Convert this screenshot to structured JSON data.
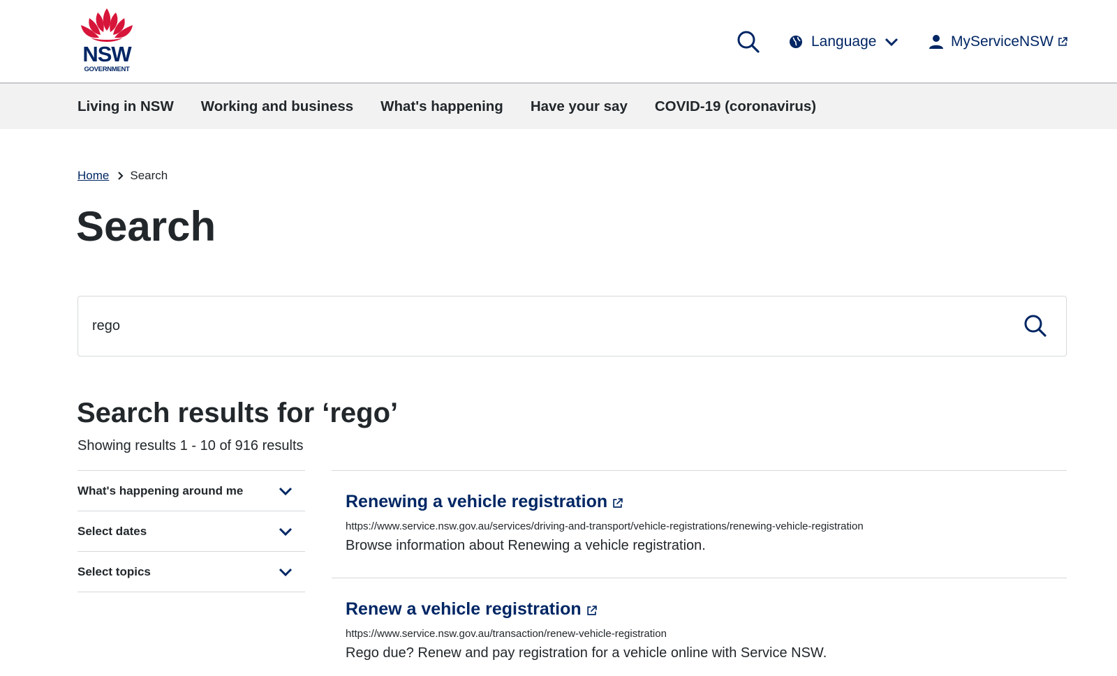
{
  "header": {
    "logo": {
      "word": "NSW",
      "sub": "GOVERNMENT"
    },
    "language_label": "Language",
    "account_label": "MyServiceNSW"
  },
  "nav": {
    "items": [
      {
        "label": "Living in NSW"
      },
      {
        "label": "Working and business"
      },
      {
        "label": "What's happening"
      },
      {
        "label": "Have your say"
      },
      {
        "label": "COVID-19 (coronavirus)"
      }
    ]
  },
  "breadcrumb": {
    "home": "Home",
    "current": "Search"
  },
  "page": {
    "title": "Search"
  },
  "search": {
    "value": "rego"
  },
  "results": {
    "heading": "Search results for ‘rego’",
    "count": "Showing results 1 - 10 of 916 results",
    "items": [
      {
        "title": "Renewing a vehicle registration",
        "url": "https://www.service.nsw.gov.au/services/driving-and-transport/vehicle-registrations/renewing-vehicle-registration",
        "description": "Browse information about Renewing a vehicle registration."
      },
      {
        "title": "Renew a vehicle registration",
        "url": "https://www.service.nsw.gov.au/transaction/renew-vehicle-registration",
        "description": "Rego due? Renew and pay registration for a vehicle online with Service NSW."
      }
    ]
  },
  "filters": [
    {
      "label": "What's happening around me"
    },
    {
      "label": "Select dates"
    },
    {
      "label": "Select topics"
    }
  ],
  "colors": {
    "brand_blue": "#002664",
    "brand_red": "#d7153a",
    "text": "#22272b",
    "nav_bg": "#f2f2f2",
    "border": "#d6d8da"
  }
}
